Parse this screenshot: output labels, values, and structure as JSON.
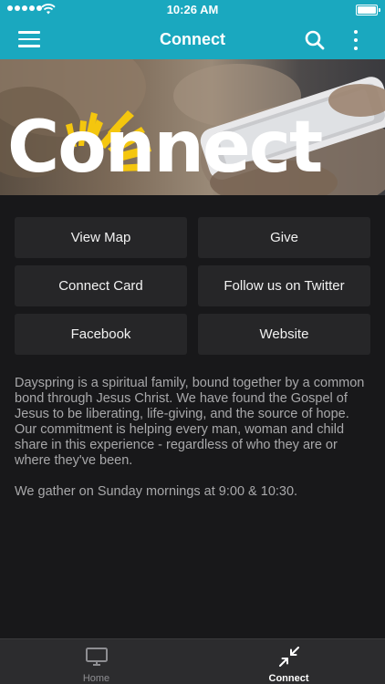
{
  "status_bar": {
    "time": "10:26 AM",
    "signal_bars": 5,
    "battery_level": 1.0
  },
  "nav": {
    "title": "Connect",
    "menu_icon": "hamburger-menu-icon",
    "search_icon": "search-icon",
    "more_icon": "vertical-ellipsis-icon"
  },
  "hero": {
    "banner_text": "Connect",
    "sun_color": "#f4c60e"
  },
  "buttons": [
    {
      "label": "View Map"
    },
    {
      "label": "Give"
    },
    {
      "label": "Connect Card"
    },
    {
      "label": "Follow us on Twitter"
    },
    {
      "label": "Facebook"
    },
    {
      "label": "Website"
    }
  ],
  "description": {
    "paragraph_1": "Dayspring is a spiritual family, bound together by a common bond through Jesus Christ. We have found the Gospel of Jesus to be liberating, life-giving, and the source of hope. Our commitment is helping every man, woman and child share in this experience - regardless of who they are or where they've been.",
    "paragraph_2": "We gather on Sunday mornings at 9:00 & 10:30."
  },
  "tabs": [
    {
      "label": "Home",
      "icon": "monitor-icon",
      "active": false
    },
    {
      "label": "Connect",
      "icon": "compress-arrows-icon",
      "active": true
    }
  ],
  "colors": {
    "accent": "#1aa8bf",
    "background": "#18181a",
    "button_bg": "#262628",
    "tab_bar_bg": "#2c2c2e"
  }
}
